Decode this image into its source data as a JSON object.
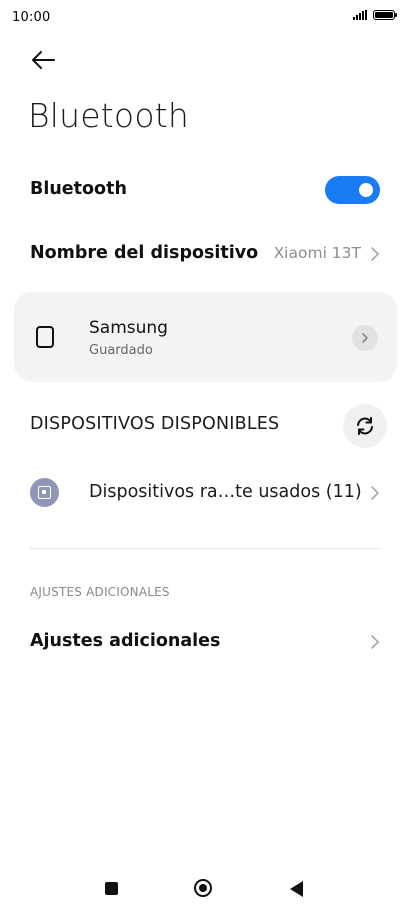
{
  "status_bar": {
    "time": "10:00",
    "icons": [
      "signal-icon",
      "battery-icon"
    ]
  },
  "header": {
    "back_icon": "back-arrow-icon",
    "title": "Bluetooth"
  },
  "bluetooth_toggle": {
    "label": "Bluetooth",
    "state": "on",
    "accent_color": "#1a7cf5"
  },
  "device_name": {
    "label": "Nombre del dispositivo",
    "value": "Xiaomi 13T"
  },
  "paired_devices": [
    {
      "name": "Samsung",
      "status": "Guardado",
      "icon": "phone-icon"
    }
  ],
  "available_section": {
    "title": "DISPOSITIVOS DISPONIBLES",
    "refresh_icon": "refresh-icon"
  },
  "recent_devices": {
    "label": "Dispositivos ra…te usados (11)",
    "icon": "device-icon"
  },
  "additional_section": {
    "title": "AJUSTES ADICIONALES",
    "item_label": "Ajustes adicionales"
  },
  "nav_bar": {
    "icons": [
      "recents-icon",
      "home-icon",
      "back-icon"
    ]
  }
}
